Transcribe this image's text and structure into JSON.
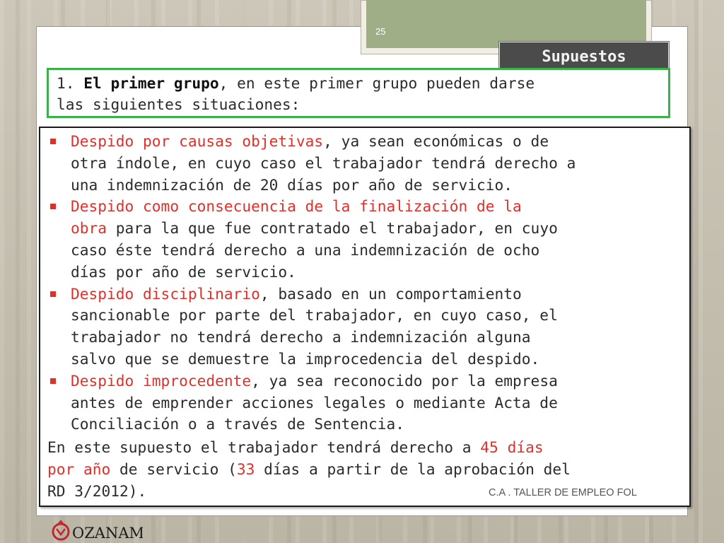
{
  "slide": {
    "page_number": "25",
    "title": "Supuestos",
    "intro": {
      "number": "1.",
      "bold": "El primer grupo",
      "rest": ", en este primer grupo pueden darse",
      "line2": "las siguientes situaciones:"
    },
    "bullets": [
      {
        "lines": [
          [
            {
              "text": " Despido por causas objetivas",
              "red": true
            },
            {
              "text": ", ya sean económicas o de",
              "red": false
            }
          ],
          [
            {
              "text": "otra índole, en cuyo caso el trabajador tendrá derecho a",
              "red": false
            }
          ],
          [
            {
              "text": "una indemnización de 20 días por año de servicio.",
              "red": false
            }
          ]
        ]
      },
      {
        "lines": [
          [
            {
              "text": " Despido como consecuencia de la finalización de la",
              "red": true
            }
          ],
          [
            {
              "text": "obra",
              "red": true
            },
            {
              "text": " para la que fue contratado el trabajador, en cuyo",
              "red": false
            }
          ],
          [
            {
              "text": "caso éste tendrá derecho a una indemnización de ocho",
              "red": false
            }
          ],
          [
            {
              "text": "días por año de servicio.",
              "red": false
            }
          ]
        ]
      },
      {
        "lines": [
          [
            {
              "text": "Despido disciplinario",
              "red": true
            },
            {
              "text": ", basado en un comportamiento",
              "red": false
            }
          ],
          [
            {
              "text": "sancionable por parte del trabajador, en cuyo caso, el",
              "red": false
            }
          ],
          [
            {
              "text": "trabajador no tendrá derecho a indemnización alguna",
              "red": false
            }
          ],
          [
            {
              "text": "salvo que se demuestre la improcedencia del despido.",
              "red": false
            }
          ]
        ]
      },
      {
        "lines": [
          [
            {
              "text": " Despido improcedente",
              "red": true
            },
            {
              "text": ", ya sea reconocido por la empresa",
              "red": false
            }
          ],
          [
            {
              "text": "antes de emprender acciones legales o mediante Acta de",
              "red": false
            }
          ],
          [
            {
              "text": "Conciliación o a través de Sentencia.",
              "red": false
            }
          ]
        ]
      }
    ],
    "conclusion": [
      [
        {
          "text": "En este supuesto el trabajador tendrá derecho a ",
          "red": false
        },
        {
          "text": "45 días",
          "red": true
        }
      ],
      [
        {
          "text": "por año",
          "red": true
        },
        {
          "text": " de servicio (",
          "red": false
        },
        {
          "text": "33",
          "red": true
        },
        {
          "text": " días a partir de la aprobación del",
          "red": false
        }
      ],
      [
        {
          "text": "RD 3/2012).",
          "red": false
        }
      ]
    ],
    "footer": "C.A . TALLER DE EMPLEO FOL",
    "logo_text": "OZANAM"
  },
  "colors": {
    "accent_red": "#e0302a",
    "frame_green": "#3cb04a",
    "tab_green": "#9fae87",
    "title_bg": "#4b4b4b"
  }
}
